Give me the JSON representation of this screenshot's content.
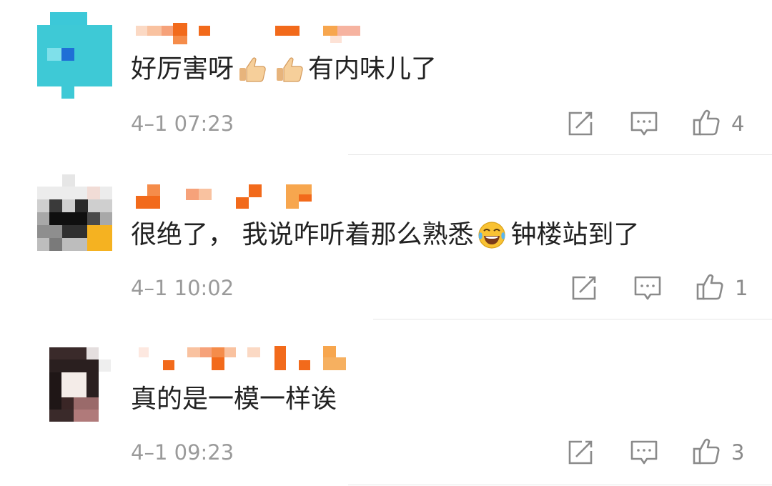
{
  "comments": [
    {
      "username": "",
      "text_before": "好厉害呀",
      "emoji_1": "thumbs-up",
      "emoji_2": "thumbs-up",
      "text_after": "有内味儿了",
      "time": "4–1 07:23",
      "likes": "4"
    },
    {
      "username": "",
      "text_before": "很绝了， 我说咋听着那么熟悉",
      "emoji_1": "tears-of-joy",
      "text_after": "钟楼站到了",
      "time": "4–1 10:02",
      "likes": "1"
    },
    {
      "username": "",
      "text": "真的是一模一样诶",
      "time": "4–1 09:23",
      "likes": "3"
    }
  ],
  "icons": {
    "reply": "share-edit-icon",
    "comment": "comment-icon",
    "like": "thumbs-up-icon"
  },
  "colors": {
    "text": "#222222",
    "meta": "#9a9a9a",
    "username_accent": "#f26a1b"
  }
}
